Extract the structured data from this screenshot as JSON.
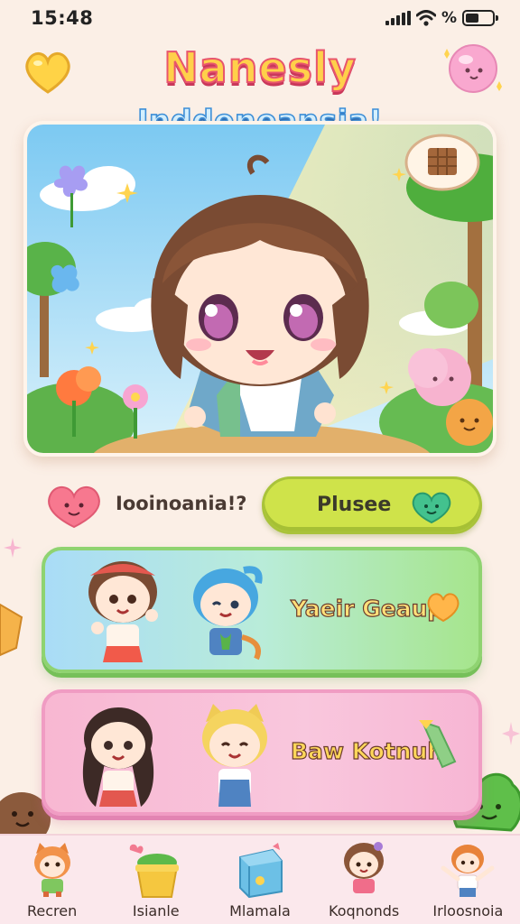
{
  "status_bar": {
    "time": "15:48",
    "percent_label": "%"
  },
  "header": {
    "title": "Nanesly",
    "subtitle": "Inddeneansia!"
  },
  "prompt": {
    "text": "Iooinoania!?",
    "pause_label": "Plusee"
  },
  "cards": [
    {
      "label": "Yaeir Geaup"
    },
    {
      "label": "Baw Kotnuh"
    }
  ],
  "bottom_nav": {
    "items": [
      {
        "label": "Recren",
        "icon": "fox-character-icon"
      },
      {
        "label": "Isianle",
        "icon": "plant-pot-icon"
      },
      {
        "label": "Mlamala",
        "icon": "gift-box-icon"
      },
      {
        "label": "Koqnonds",
        "icon": "girl-character-icon"
      },
      {
        "label": "Irloosnoia",
        "icon": "kid-waving-icon"
      }
    ]
  },
  "colors": {
    "background": "#fbefe6",
    "title_fill": "#ffd04a",
    "title_stroke": "#e8556d",
    "subtitle_fill": "#d4f0ff",
    "pause_button": "#cfe34a",
    "card_green": "#a6e58c",
    "card_pink": "#f8b7d2",
    "nav_bg": "#fbe8ec"
  }
}
